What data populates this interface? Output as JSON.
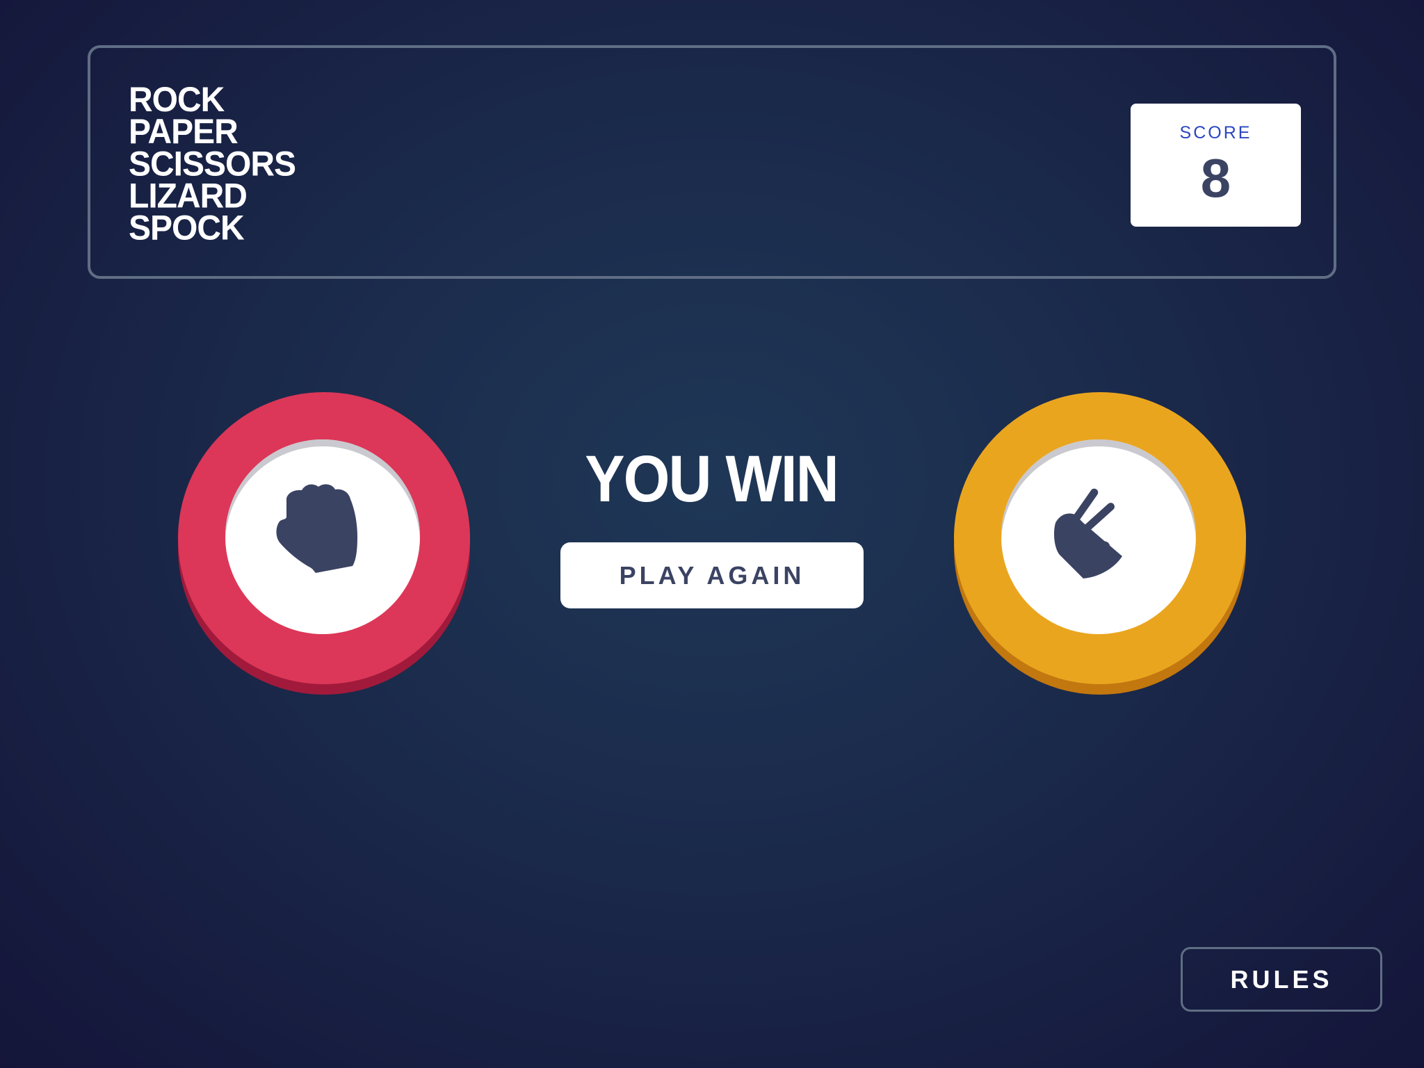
{
  "header": {
    "logo_lines": [
      "ROCK",
      "PAPER",
      "SCISSORS",
      "LIZARD",
      "SPOCK"
    ],
    "score": {
      "label": "SCORE",
      "value": "8"
    }
  },
  "game": {
    "player_choice": {
      "name": "rock",
      "icon": "rock-fist-icon",
      "ring_color": "#dc3758"
    },
    "house_choice": {
      "name": "scissors",
      "icon": "scissors-hand-icon",
      "ring_color": "#eaa51f"
    },
    "result_text": "YOU WIN",
    "play_again_label": "PLAY AGAIN"
  },
  "footer": {
    "rules_label": "RULES"
  },
  "colors": {
    "score_label": "#2a46c0",
    "dark_text": "#3b4363",
    "outline": "#606e85"
  }
}
